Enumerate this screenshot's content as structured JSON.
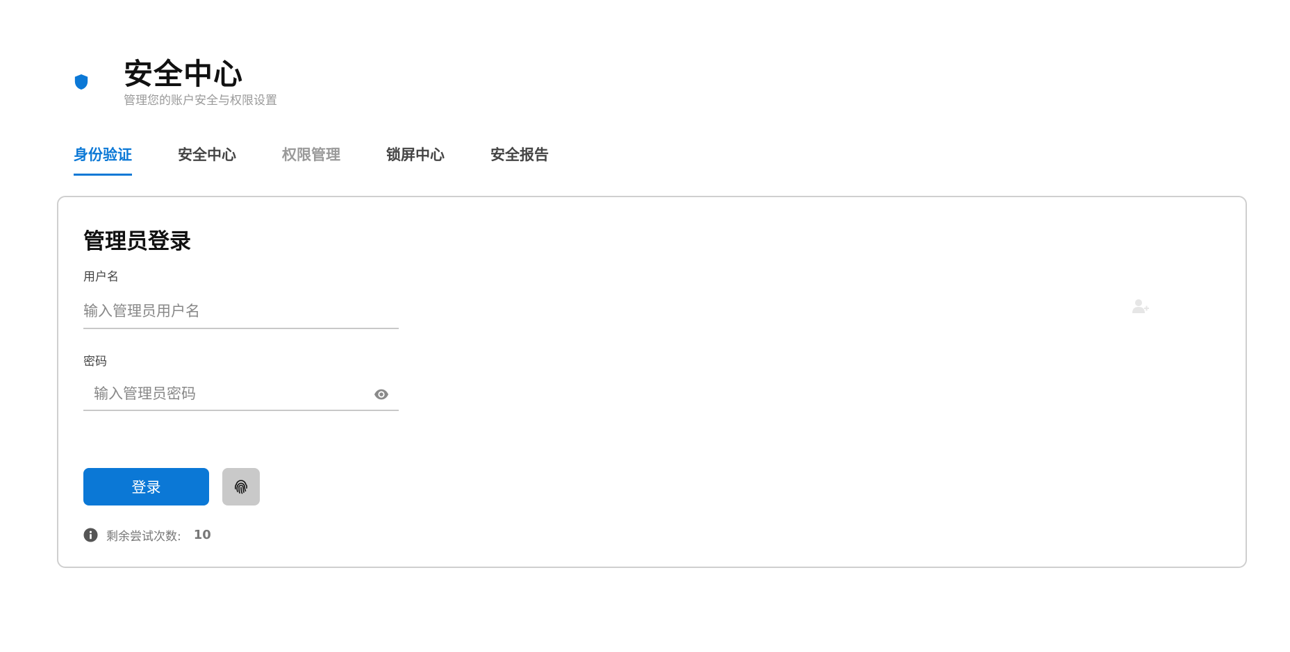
{
  "header": {
    "title": "安全中心",
    "subtitle": "管理您的账户安全与权限设置",
    "icon": "shield-icon",
    "accent_color": "#0b78d6"
  },
  "tabs": [
    {
      "label": "身份验证",
      "state": "active"
    },
    {
      "label": "安全中心",
      "state": "normal"
    },
    {
      "label": "权限管理",
      "state": "disabled"
    },
    {
      "label": "锁屏中心",
      "state": "normal"
    },
    {
      "label": "安全报告",
      "state": "normal"
    }
  ],
  "login": {
    "title": "管理员登录",
    "username_label": "用户名",
    "username_placeholder": "输入管理员用户名",
    "username_value": "",
    "password_label": "密码",
    "password_placeholder": "输入管理员密码",
    "password_value": "",
    "submit_label": "登录",
    "fingerprint_icon": "fingerprint-icon",
    "toggle_visibility_icon": "eye-icon",
    "attempts_label": "剩余尝试次数:",
    "attempts_count": "10"
  }
}
